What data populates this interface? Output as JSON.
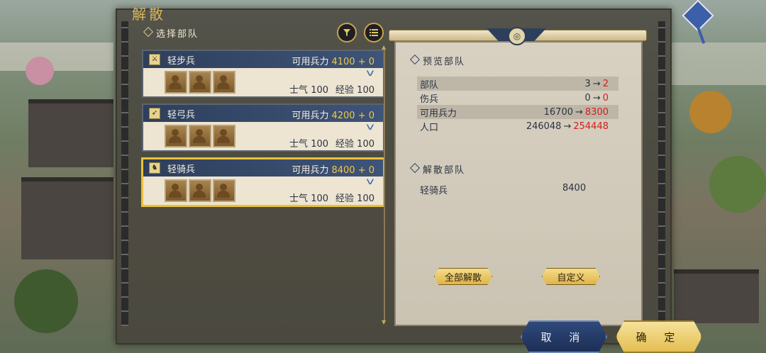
{
  "window": {
    "title": "解散"
  },
  "left_panel": {
    "section_title": "选择部队",
    "filter_icon": "filter-funnel-icon",
    "list_icon": "list-icon",
    "units": [
      {
        "type_icon": "infantry-icon",
        "name": "轻步兵",
        "avail_label": "可用兵力",
        "avail_value": "4100 + 0",
        "morale_label": "士气",
        "morale_value": "100",
        "exp_label": "经验",
        "exp_value": "100",
        "selected": false
      },
      {
        "type_icon": "archer-icon",
        "name": "轻弓兵",
        "avail_label": "可用兵力",
        "avail_value": "4200 + 0",
        "morale_label": "士气",
        "morale_value": "100",
        "exp_label": "经验",
        "exp_value": "100",
        "selected": false
      },
      {
        "type_icon": "cavalry-icon",
        "name": "轻骑兵",
        "avail_label": "可用兵力",
        "avail_value": "8400 + 0",
        "morale_label": "士气",
        "morale_value": "100",
        "exp_label": "经验",
        "exp_value": "100",
        "selected": true
      }
    ]
  },
  "right_panel": {
    "preview_title": "预览部队",
    "preview_rows": [
      {
        "label": "部队",
        "old": "3",
        "arrow": "→",
        "new": "2"
      },
      {
        "label": "伤兵",
        "old": "0",
        "arrow": "→",
        "new": "0"
      },
      {
        "label": "可用兵力",
        "old": "16700",
        "arrow": "→",
        "new": "8300"
      },
      {
        "label": "人口",
        "old": "246048",
        "arrow": "→",
        "new": "254448"
      }
    ],
    "disband_title": "解散部队",
    "disband_unit": "轻骑兵",
    "disband_value": "8400",
    "btn_disband_all": "全部解散",
    "btn_custom": "自定义"
  },
  "footer": {
    "cancel": "取 消",
    "confirm": "确 定"
  },
  "colors": {
    "accent_gold": "#e8c23a",
    "increase_red": "#d02020",
    "header_navy": "#2e3f5c"
  }
}
